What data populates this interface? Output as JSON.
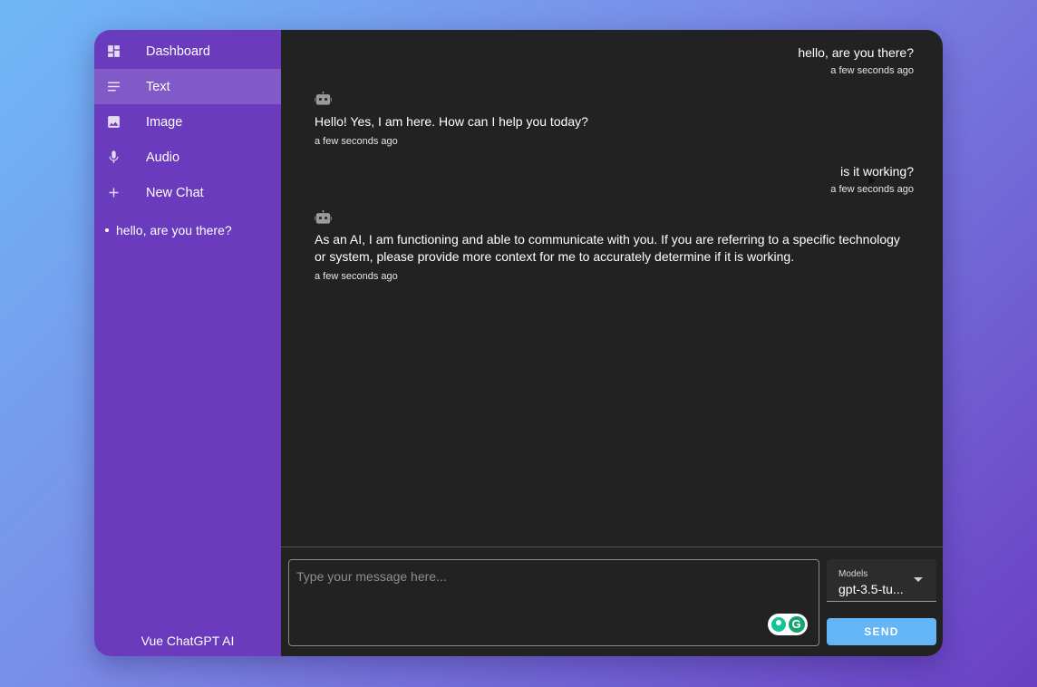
{
  "sidebar": {
    "items": [
      {
        "label": "Dashboard",
        "icon": "dashboard-icon"
      },
      {
        "label": "Text",
        "icon": "text-lines-icon",
        "active": true
      },
      {
        "label": "Image",
        "icon": "image-icon"
      },
      {
        "label": "Audio",
        "icon": "microphone-icon"
      },
      {
        "label": "New Chat",
        "icon": "plus-icon"
      }
    ],
    "history": [
      "hello, are you there?"
    ],
    "footer": "Vue ChatGPT AI"
  },
  "messages": [
    {
      "role": "user",
      "text": "hello, are you there?",
      "time": "a few seconds ago"
    },
    {
      "role": "assistant",
      "icon": "robot-icon",
      "text": "Hello! Yes, I am here. How can I help you today?",
      "time": "a few seconds ago"
    },
    {
      "role": "user",
      "text": "is it working?",
      "time": "a few seconds ago"
    },
    {
      "role": "assistant",
      "icon": "robot-icon",
      "text": "As an AI, I am functioning and able to communicate with you. If you are referring to a specific technology or system, please provide more context for me to accurately determine if it is working.",
      "time": "a few seconds ago"
    }
  ],
  "composer": {
    "placeholder": "Type your message here...",
    "model_label": "Models",
    "model_value": "gpt-3.5-tu...",
    "send_label": "SEND"
  },
  "colors": {
    "sidebar_bg": "#6a3bbd",
    "main_bg": "#222222",
    "send_button": "#64b5f6",
    "grammarly": "#15c39a"
  }
}
